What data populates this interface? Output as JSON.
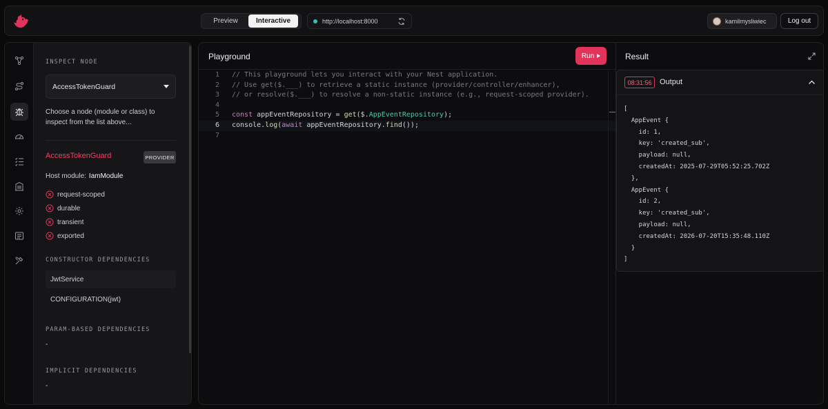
{
  "header": {
    "view_modes": [
      "Preview",
      "Interactive"
    ],
    "active_view": "Interactive",
    "url": "http://localhost:8000",
    "username": "kamilmysliwiec",
    "logout_label": "Log out"
  },
  "inspect": {
    "section_title": "INSPECT NODE",
    "selected_node": "AccessTokenGuard",
    "hint": "Choose a node (module or class) to inspect from the list above...",
    "node_name": "AccessTokenGuard",
    "node_type": "PROVIDER",
    "host_label": "Host module:",
    "host_value": "IamModule",
    "flags": [
      "request-scoped",
      "durable",
      "transient",
      "exported"
    ],
    "constructor_title": "CONSTRUCTOR DEPENDENCIES",
    "constructor_deps": [
      "JwtService",
      "CONFIGURATION(jwt)"
    ],
    "param_title": "PARAM-BASED DEPENDENCIES",
    "param_value": "-",
    "implicit_title": "IMPLICIT DEPENDENCIES",
    "implicit_value": "-"
  },
  "playground": {
    "title": "Playground",
    "run_label": "Run",
    "lines": [
      {
        "n": "1",
        "text": "// This playground lets you interact with your Nest application."
      },
      {
        "n": "2",
        "text": "// Use get($.___) to retrieve a static instance (provider/controller/enhancer),"
      },
      {
        "n": "3",
        "text": "// or resolve($.___) to resolve a non-static instance (e.g., request-scoped provider)."
      },
      {
        "n": "4",
        "text": ""
      },
      {
        "n": "5",
        "text": "const appEventRepository = get($.AppEventRepository);"
      },
      {
        "n": "6",
        "text": "console.log(await appEventRepository.find());"
      },
      {
        "n": "7",
        "text": ""
      }
    ]
  },
  "result": {
    "title": "Result",
    "timestamp": "08:31:56",
    "output_label": "Output",
    "output_lines": [
      "[",
      "  AppEvent {",
      "    id: 1,",
      "    key: 'created_sub',",
      "    payload: null,",
      "    createdAt: 2025-07-29T05:52:25.702Z",
      "  },",
      "  AppEvent {",
      "    id: 2,",
      "    key: 'created_sub',",
      "    payload: null,",
      "    createdAt: 2026-07-20T15:35:48.110Z",
      "  }",
      "]"
    ]
  },
  "colors": {
    "accent": "#e2345a",
    "node_name": "#ef4462",
    "status_dot": "#38bdb8"
  },
  "rail_icons": [
    "modules-graph-icon",
    "routes-icon",
    "bug-icon",
    "dashboard-gauge-icon",
    "checklist-icon",
    "building-icon",
    "settings-gear-icon",
    "logs-icon",
    "tools-icon"
  ]
}
